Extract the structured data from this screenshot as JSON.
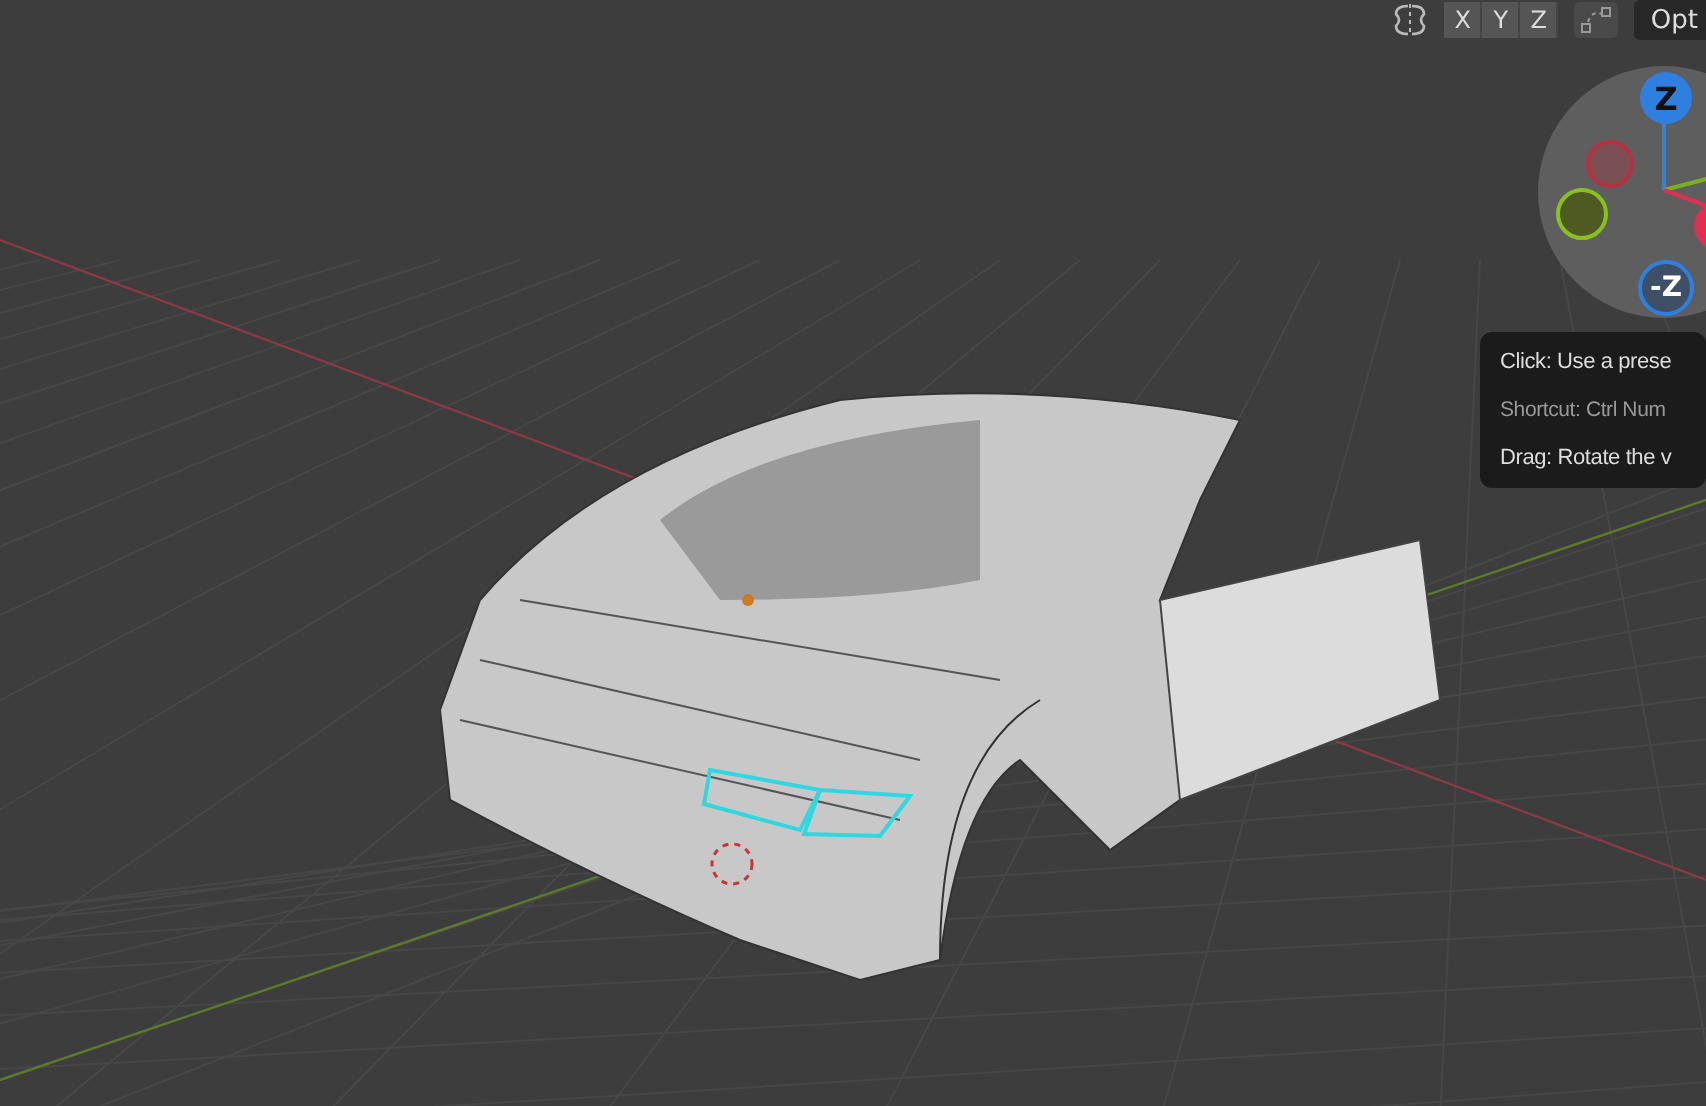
{
  "header": {
    "axis_buttons": [
      {
        "label": "X",
        "selected": false
      },
      {
        "label": "Y",
        "selected": false
      },
      {
        "label": "Z",
        "selected": false
      }
    ],
    "options_label": "Opt"
  },
  "gizmo": {
    "top_label": "Z",
    "bottom_label": "-Z"
  },
  "tooltip": {
    "lines": [
      "Click: Use a prese",
      "Shortcut: Ctrl Num",
      "Drag: Rotate the v"
    ]
  }
}
